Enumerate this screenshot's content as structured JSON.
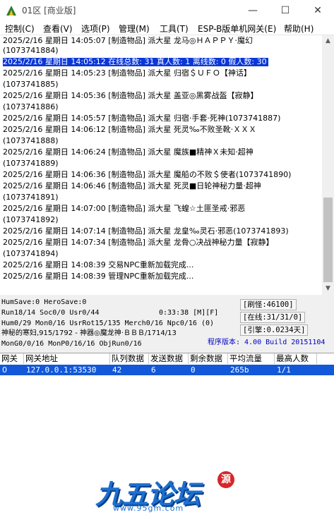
{
  "window": {
    "title": "01区 [商业版]",
    "min": "—",
    "max": "☐",
    "close": "✕"
  },
  "menu": [
    "控制(C)",
    "查看(V)",
    "选项(P)",
    "管理(M)",
    "工具(T)",
    "ESP-B版单机网关(E)",
    "帮助(H)"
  ],
  "log": [
    {
      "text": "2025/2/16 星期日 14:05:07 [制造物品] 派大星 龙马◎ＨＡＰＰＹ·魔幻",
      "sel": false
    },
    {
      "text": "(1073741884)",
      "sel": false
    },
    {
      "text": "2025/2/16 星期日 14:05:12 在线总数: 31 真人数: 1 离线数: 0 假人数: 30",
      "sel": true
    },
    {
      "text": "2025/2/16 星期日 14:05:23 [制造物品] 派大星 归宿＄ＵＦＯ【神话】",
      "sel": false
    },
    {
      "text": "(1073741885)",
      "sel": false
    },
    {
      "text": "2025/2/16 星期日 14:05:36 [制造物品] 派大星 盖亚◎黑雾战盔【寂静】",
      "sel": false
    },
    {
      "text": "(1073741886)",
      "sel": false
    },
    {
      "text": "2025/2/16 星期日 14:05:57 [制造物品] 派大星 归宿·手套·死神(1073741887)",
      "sel": false
    },
    {
      "text": "2025/2/16 星期日 14:06:12 [制造物品] 派大星 死灵‰不败圣靴·ＸＸＸ",
      "sel": false
    },
    {
      "text": "(1073741888)",
      "sel": false
    },
    {
      "text": "2025/2/16 星期日 14:06:24 [制造物品] 派大星 魔族■精神Ｘ未知·超神",
      "sel": false
    },
    {
      "text": "(1073741889)",
      "sel": false
    },
    {
      "text": "2025/2/16 星期日 14:06:36 [制造物品] 派大星 魔船の不败＄使者(1073741890)",
      "sel": false
    },
    {
      "text": "2025/2/16 星期日 14:06:46 [制造物品] 派大星 死灵■日轮神秘力量·超神",
      "sel": false
    },
    {
      "text": "(1073741891)",
      "sel": false
    },
    {
      "text": "2025/2/16 星期日 14:07:00 [制造物品] 派大星 飞蝗☆土匪圣戒·邪恶",
      "sel": false
    },
    {
      "text": "(1073741892)",
      "sel": false
    },
    {
      "text": "2025/2/16 星期日 14:07:14 [制造物品] 派大星 龙皇‰灵石·邪恶(1073741893)",
      "sel": false
    },
    {
      "text": "2025/2/16 星期日 14:07:34 [制造物品] 派大星 龙骨○决战神秘力量【寂静】",
      "sel": false
    },
    {
      "text": "(1073741894)",
      "sel": false
    },
    {
      "text": "2025/2/16 星期日 14:08:39 交易NPC重新加载完成...",
      "sel": false
    },
    {
      "text": "2025/2/16 星期日 14:08:39 管理NPC重新加载完成...",
      "sel": false
    }
  ],
  "status": {
    "line1": "HumSave:0 HeroSave:0",
    "line2": "Run18/14 Soc0/0 Usr0/44",
    "timer": "0:33:38 [M][F]",
    "line3": "Hum0/29 Mon0/16 UsrRot15/135 Merch0/16 Npc0/16 (0)",
    "line4": "神秘的寒妇,915/1792 - 神器◎魔龙神·ＢＢＢ/1714/13",
    "line5": "MonG0/0/16 MonP0/16/16 ObjRun0/16",
    "refresh": "[刷怪:46100]",
    "online": "[在线:31/31/0]",
    "engine": "[引擎:0.0234天]",
    "version": "程序版本: 4.00 Build 20151104"
  },
  "gateway": {
    "headers": [
      "网关",
      "网关地址",
      "队列数据",
      "发送数据",
      "剩余数据",
      "平均流量",
      "最高人数"
    ],
    "rows": [
      [
        "0",
        "127.0.0.1:53530",
        "42",
        "6",
        "0",
        "265b",
        "1/1"
      ]
    ]
  },
  "watermark": {
    "text": "九五论坛",
    "url": "www.95gm.com",
    "seal": "源"
  }
}
